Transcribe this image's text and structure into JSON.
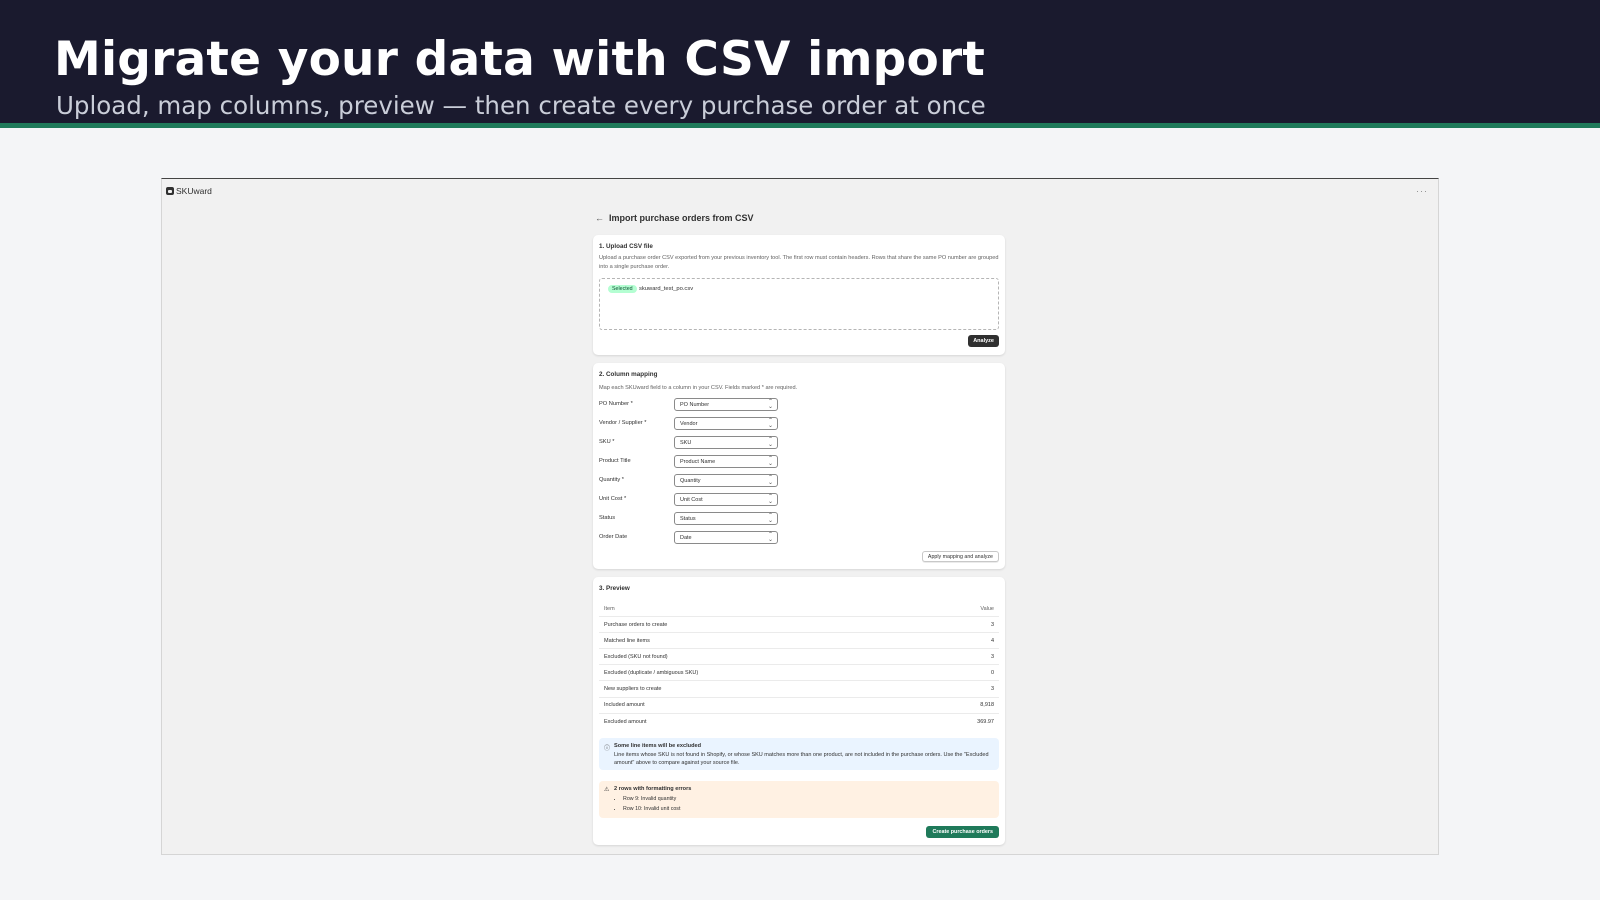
{
  "slide": {
    "title": "Migrate your data with CSV import",
    "subtitle": "Upload, map columns, preview — then create every purchase order at once"
  },
  "app": {
    "name": "SKUward",
    "menu_icon": "more-dots-icon"
  },
  "page": {
    "back_icon": "←",
    "title": "Import purchase orders from CSV"
  },
  "upload": {
    "title": "1. Upload CSV file",
    "description": "Upload a purchase order CSV exported from your previous inventory tool. The first row must contain headers. Rows that share the same PO number are grouped into a single purchase order.",
    "badge": "Selected",
    "file_name": "skuward_test_po.csv",
    "analyze_label": "Analyze"
  },
  "mapping": {
    "title": "2. Column mapping",
    "description": "Map each SKUward field to a column in your CSV. Fields marked * are required.",
    "rows": [
      {
        "label": "PO Number *",
        "value": "PO Number"
      },
      {
        "label": "Vendor / Supplier *",
        "value": "Vendor"
      },
      {
        "label": "SKU *",
        "value": "SKU"
      },
      {
        "label": "Product Title",
        "value": "Product Name"
      },
      {
        "label": "Quantity *",
        "value": "Quantity"
      },
      {
        "label": "Unit Cost *",
        "value": "Unit Cost"
      },
      {
        "label": "Status",
        "value": "Status"
      },
      {
        "label": "Order Date",
        "value": "Date"
      }
    ],
    "apply_label": "Apply mapping and analyze"
  },
  "preview": {
    "title": "3. Preview",
    "columns": [
      "Item",
      "Value"
    ],
    "rows": [
      [
        "Purchase orders to create",
        "3"
      ],
      [
        "Matched line items",
        "4"
      ],
      [
        "Excluded (SKU not found)",
        "3"
      ],
      [
        "Excluded (duplicate / ambiguous SKU)",
        "0"
      ],
      [
        "New suppliers to create",
        "3"
      ],
      [
        "Included amount",
        "8,918"
      ],
      [
        "Excluded amount",
        "369.97"
      ]
    ],
    "info_banner": {
      "title": "Some line items will be excluded",
      "text": "Line items whose SKU is not found in Shopify, or whose SKU matches more than one product, are not included in the purchase orders. Use the \"Excluded amount\" above to compare against your source file."
    },
    "warning_banner": {
      "title": "2 rows with formatting errors",
      "items": [
        "Row 9: Invalid quantity",
        "Row 10: Invalid unit cost"
      ]
    },
    "create_label": "Create purchase orders"
  },
  "colors": {
    "hero_bg": "#1a1a2e",
    "accent_green": "#1f7a5a",
    "info_bg": "#eaf4ff",
    "warn_bg": "#fff1e3",
    "badge_bg": "#b4fed2"
  }
}
